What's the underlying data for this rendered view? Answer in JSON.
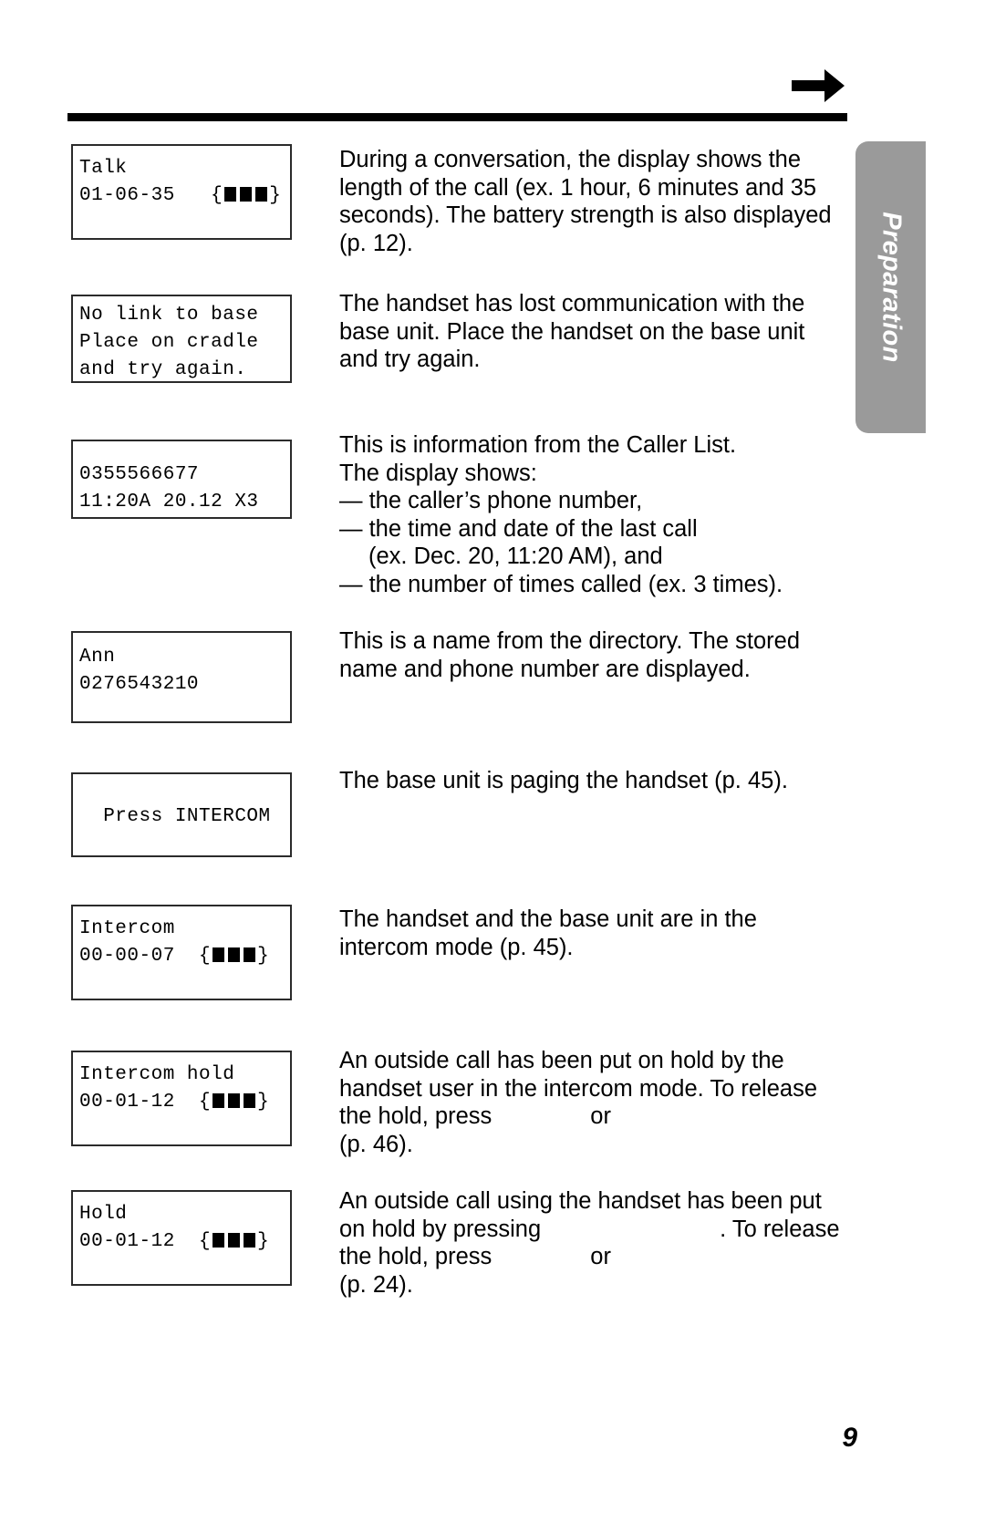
{
  "page": {
    "number": "9",
    "side_tab_label": "Preparation",
    "arrow_icon": "right-arrow-icon"
  },
  "entries": [
    {
      "id": "talk",
      "display": {
        "lines": [
          "Talk",
          "",
          "01-06-35   {"
        ],
        "battery_bars": 3,
        "battery_suffix": "}"
      },
      "description": "During a conversation, the display shows the length of the call (ex. 1 hour, 6 minutes and 35 seconds). The battery strength is also displayed (p. 12)."
    },
    {
      "id": "no-link-to-base",
      "display": {
        "lines": [
          "No link to base",
          "Place on cradle",
          "and try again."
        ],
        "battery_bars": 0,
        "battery_suffix": ""
      },
      "description": "The handset has lost communication with the base unit. Place the handset on the base unit and try again."
    },
    {
      "id": "caller-list",
      "display": {
        "lines": [
          "",
          "0355566677",
          "11:20A 20.12 X3"
        ],
        "battery_bars": 0,
        "battery_suffix": ""
      },
      "description_lines": [
        "This is information from the Caller List.",
        "The display shows:",
        "— the caller’s phone number,",
        "— the time and date of the last call",
        "(ex. Dec. 20, 11:20 AM), and",
        "— the number of times called (ex. 3 times)."
      ]
    },
    {
      "id": "directory-name",
      "display": {
        "lines": [
          "Ann",
          "0276543210",
          ""
        ],
        "battery_bars": 0,
        "battery_suffix": ""
      },
      "description": "This is a name from the directory. The stored name and phone number are displayed."
    },
    {
      "id": "press-intercom",
      "display": {
        "lines": [
          "",
          "  Press INTERCOM",
          ""
        ],
        "battery_bars": 0,
        "battery_suffix": ""
      },
      "description": "The base unit is paging the handset (p. 45)."
    },
    {
      "id": "intercom",
      "display": {
        "lines": [
          "Intercom",
          "",
          "00-00-07  {"
        ],
        "battery_bars": 3,
        "battery_suffix": "}"
      },
      "description": "The handset and the base unit are in the intercom mode (p. 45)."
    },
    {
      "id": "intercom-hold",
      "display": {
        "lines": [
          "Intercom hold",
          "",
          "00-01-12  {"
        ],
        "battery_bars": 3,
        "battery_suffix": "}"
      },
      "description_parts": {
        "line1": "An outside call has been put on hold by the",
        "line2": "handset user in the intercom mode. To release",
        "line3_a": "the hold, press",
        "line3_b": "or",
        "line4": "(p. 46)."
      }
    },
    {
      "id": "hold",
      "display": {
        "lines": [
          "Hold",
          "",
          "00-01-12  {"
        ],
        "battery_bars": 3,
        "battery_suffix": "}"
      },
      "description_parts": {
        "line1": "An outside call using the handset has been put",
        "line2_a": "on hold by pressing",
        "line2_b": ". To release",
        "line3_a": "the hold, press",
        "line3_b": "or",
        "line4": "(p. 24)."
      }
    }
  ]
}
